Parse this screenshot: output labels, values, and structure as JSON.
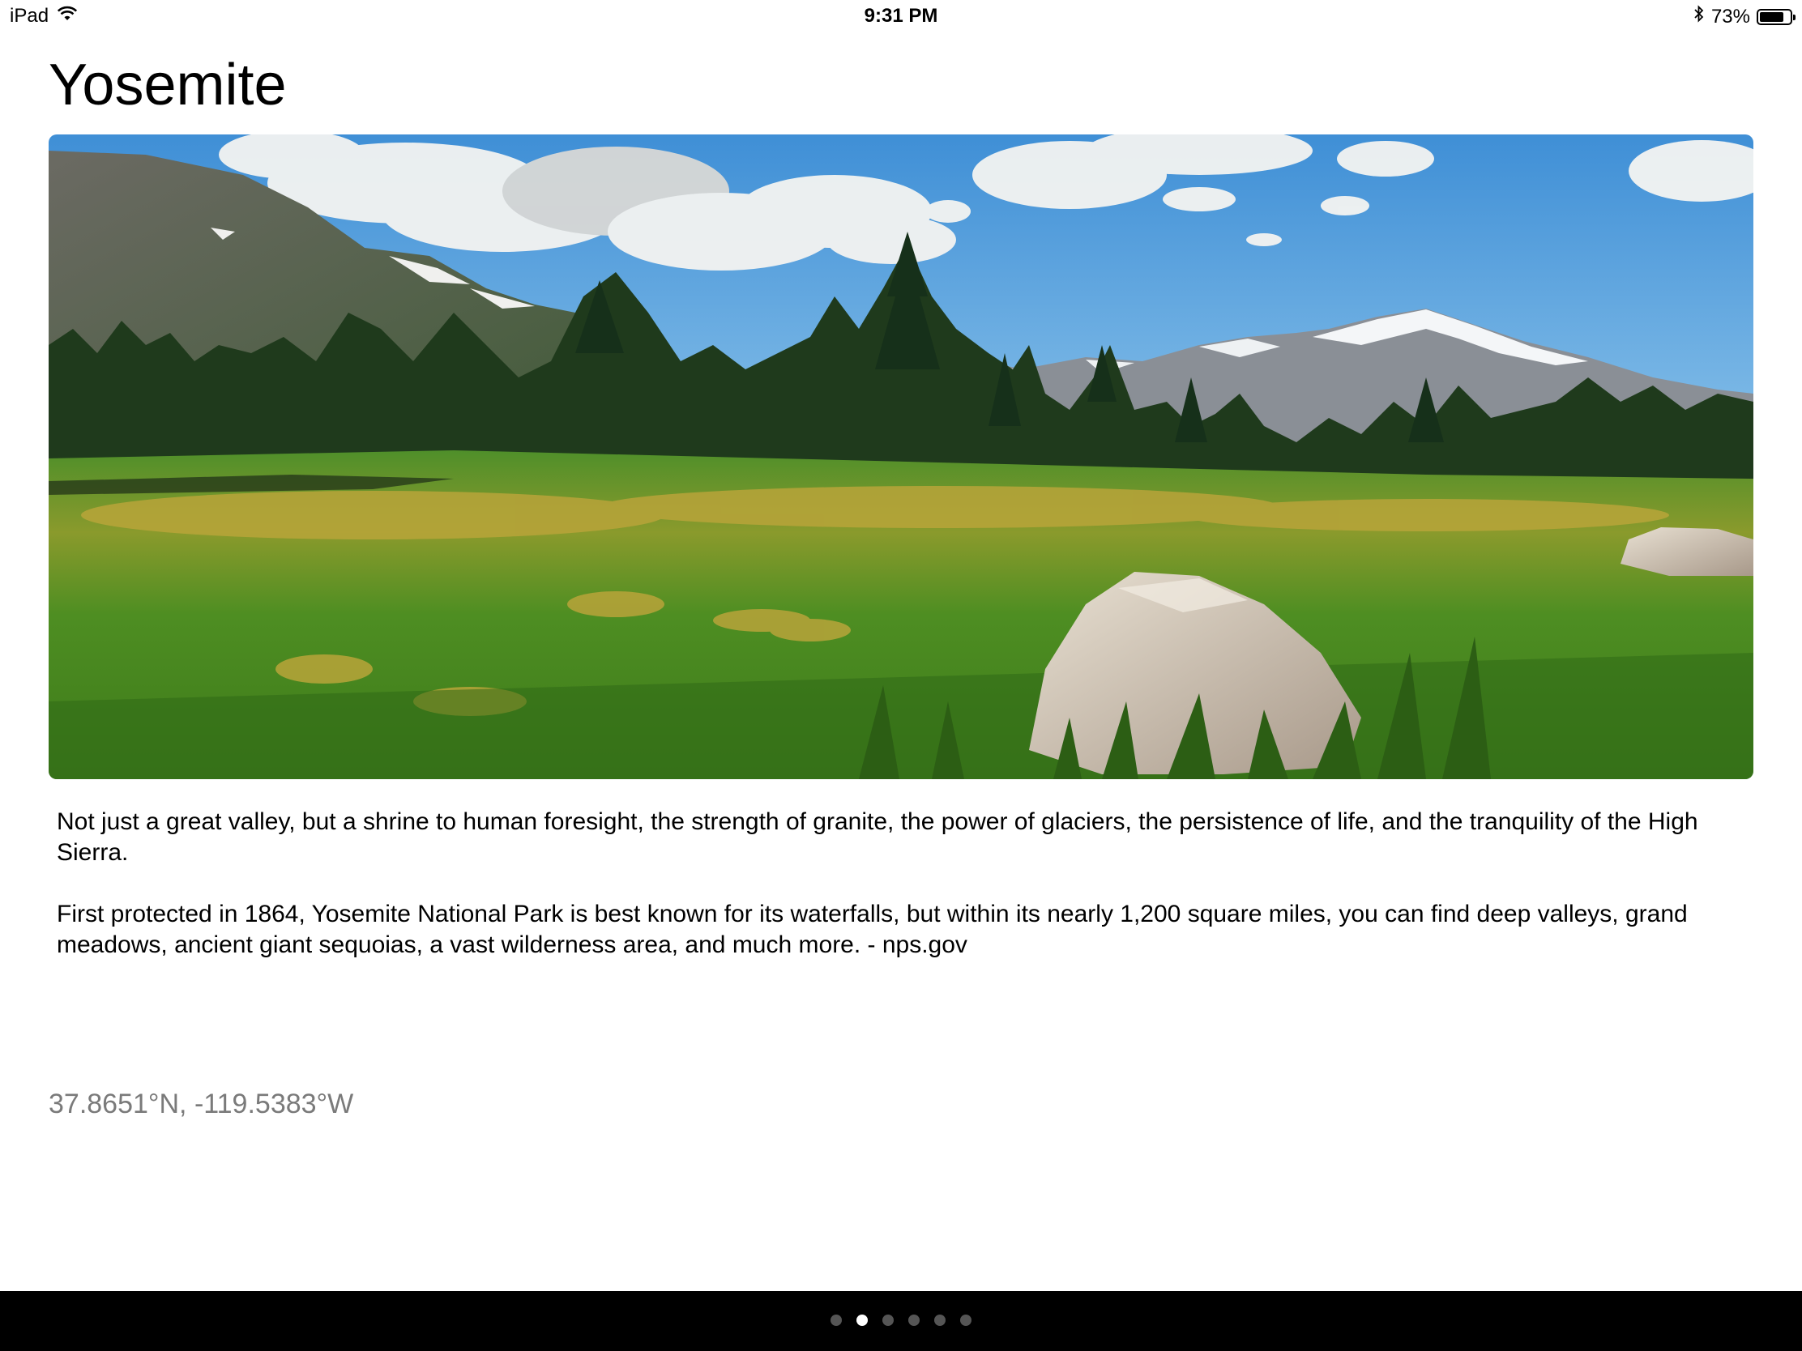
{
  "status_bar": {
    "device": "iPad",
    "time": "9:31 PM",
    "battery_percent": "73%",
    "icons": [
      "wifi-icon",
      "bluetooth-icon",
      "battery-icon"
    ]
  },
  "park": {
    "title": "Yosemite",
    "image_alt": "Meadow with granite boulder, pine trees and snow-capped mountains",
    "description_1": "Not just a great valley, but a shrine to human foresight, the strength of granite, the power of glaciers, the persistence of life, and the tranquility of the High Sierra.",
    "description_2": "First protected in 1864, Yosemite National Park is best known for its waterfalls, but within its nearly 1,200 square miles, you can find deep valleys, grand meadows, ancient giant sequoias, a vast wilderness area, and much more. - nps.gov",
    "coordinates": "37.8651°N, -119.5383°W"
  },
  "page_control": {
    "total": 6,
    "current": 2
  },
  "colors": {
    "coords_gray": "#7a7a7a",
    "bottom_bar": "#000000"
  }
}
